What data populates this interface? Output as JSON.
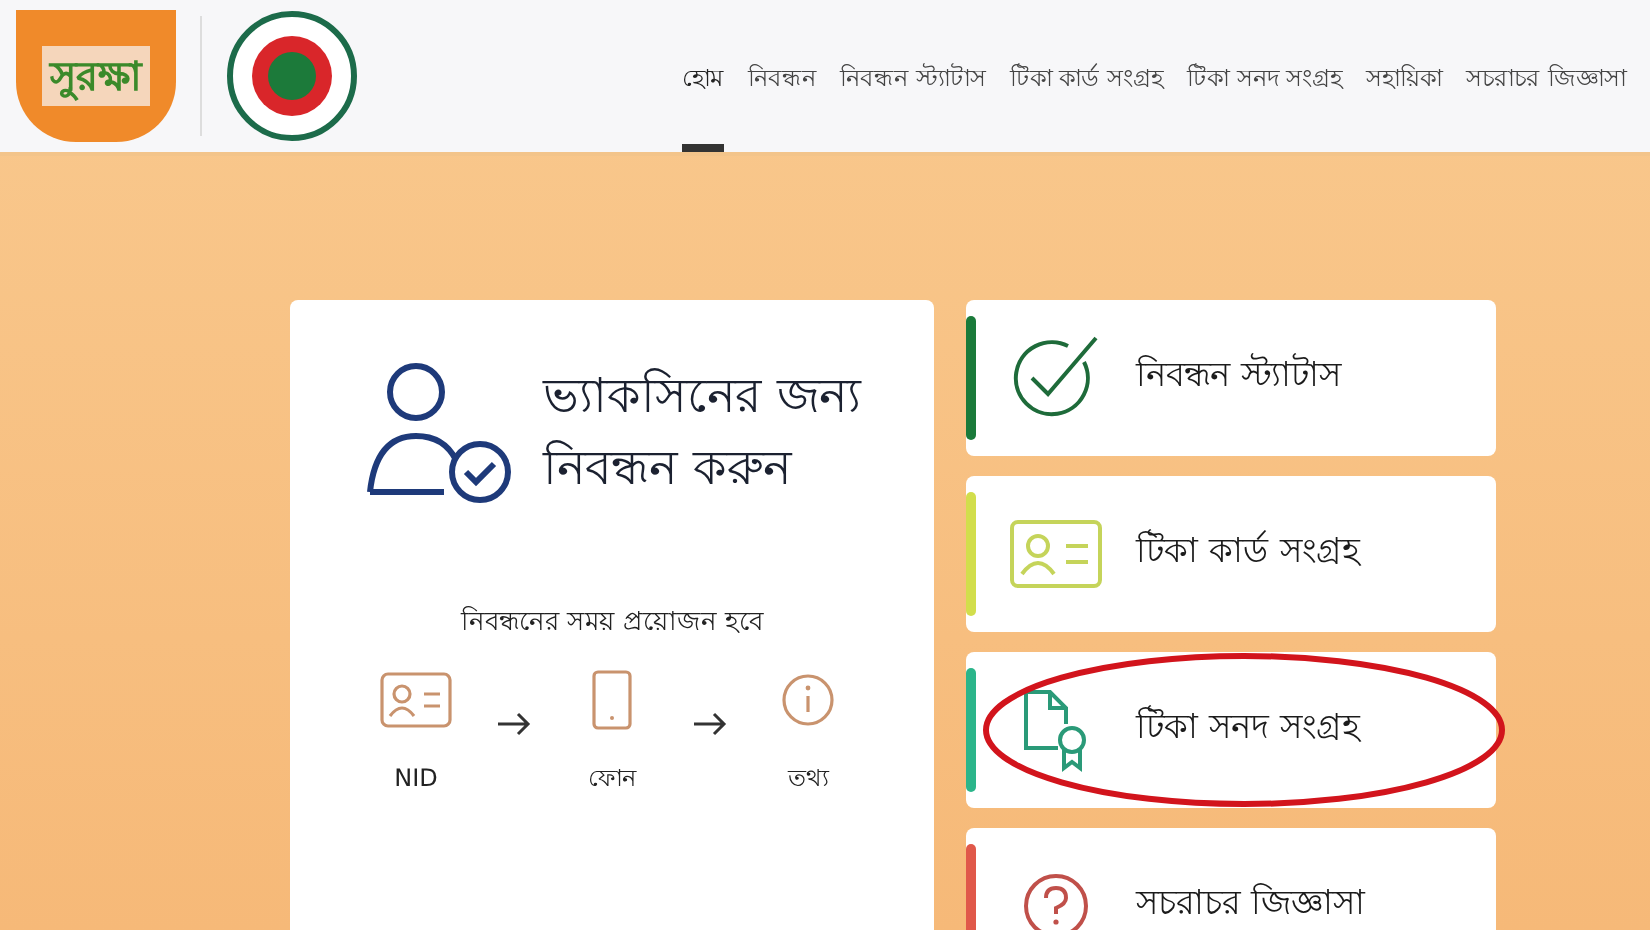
{
  "logo": {
    "text": "সুরক্ষা"
  },
  "nav": [
    {
      "label": "হোম",
      "selected": true
    },
    {
      "label": "নিবন্ধন",
      "selected": false
    },
    {
      "label": "নিবন্ধন স্ট্যাটাস",
      "selected": false
    },
    {
      "label": "টিকা কার্ড সংগ্রহ",
      "selected": false
    },
    {
      "label": "টিকা সনদ সংগ্রহ",
      "selected": false
    },
    {
      "label": "সহায়িকা",
      "selected": false
    },
    {
      "label": "সচরাচর জিজ্ঞাসা",
      "selected": false
    }
  ],
  "register_card": {
    "title_line_1": "ভ্যাকসিনের জন্য",
    "title_line_2": "নিবন্ধন করুন",
    "requirements_heading": "নিবন্ধনের সময় প্রয়োজন হবে",
    "requirements": [
      {
        "kind": "idcard",
        "label": "NID"
      },
      {
        "kind": "phone",
        "label": "ফোন"
      },
      {
        "kind": "info",
        "label": "তথ্য"
      }
    ]
  },
  "action_cards": [
    {
      "kind": "check",
      "label": "নিবন্ধন স্ট্যাটাস",
      "color": "#1a7a3a",
      "circled": false
    },
    {
      "kind": "idcard",
      "label": "টিকা কার্ড সংগ্রহ",
      "color": "#d2de4c",
      "circled": false
    },
    {
      "kind": "certificate",
      "label": "টিকা সনদ সংগ্রহ",
      "color": "#2bb58a",
      "circled": true
    },
    {
      "kind": "question",
      "label": "সচরাচর জিজ্ঞাসা",
      "color": "#e0584a",
      "circled": false
    }
  ]
}
